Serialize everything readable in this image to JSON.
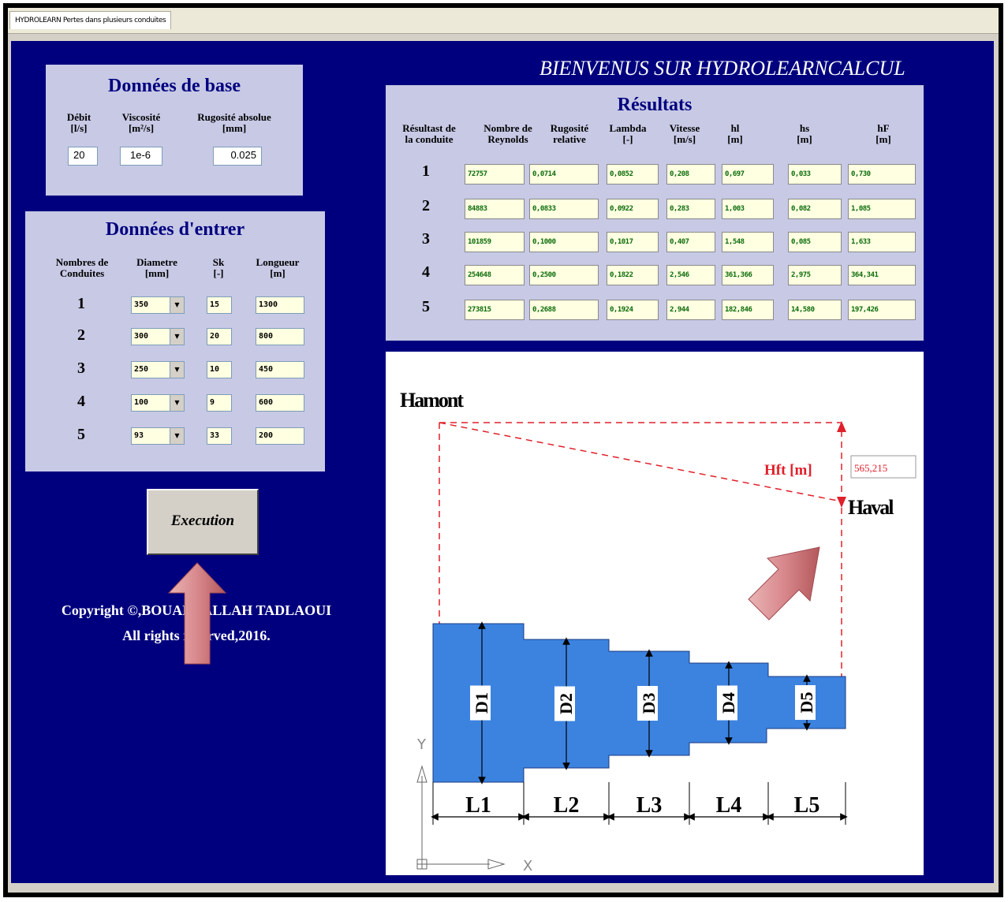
{
  "window": {
    "tab_title": "HYDROLEARN Pertes dans plusieurs conduites"
  },
  "app_title": "BIENVENUS SUR HYDROLEARNCALCUL",
  "base": {
    "title": "Données de base",
    "debit_label": [
      "Débit",
      "[l/s]"
    ],
    "visc_label": [
      "Viscosité",
      "[m²/s]"
    ],
    "rug_label": [
      "Rugosité absolue",
      "[mm]"
    ],
    "debit": "20",
    "viscosite": "1e-6",
    "rugosite": "0.025"
  },
  "entrer": {
    "title": "Données d'entrer",
    "headers": [
      [
        "Nombres de",
        "Conduites"
      ],
      [
        "Diametre",
        "[mm]"
      ],
      [
        "Sk",
        "[-]"
      ],
      [
        "Longueur",
        "[m]"
      ]
    ],
    "rows": [
      {
        "n": "1",
        "d": "350",
        "sk": "15",
        "l": "1300"
      },
      {
        "n": "2",
        "d": "300",
        "sk": "20",
        "l": "800"
      },
      {
        "n": "3",
        "d": "250",
        "sk": "10",
        "l": "450"
      },
      {
        "n": "4",
        "d": "100",
        "sk": "9",
        "l": "600"
      },
      {
        "n": "5",
        "d": "93",
        "sk": "33",
        "l": "200"
      }
    ]
  },
  "execute_label": "Execution",
  "copyright": [
    "Copyright ©,BOUABDALLAH TADLAOUI",
    "All rights reserved,2016."
  ],
  "results": {
    "title": "Résultats",
    "headers": [
      [
        "Résultast de",
        "la conduite"
      ],
      [
        "Nombre de",
        "Reynolds"
      ],
      [
        "Rugosité",
        "relative"
      ],
      [
        "Lambda",
        "[-]"
      ],
      [
        "Vitesse",
        "[m/s]"
      ],
      [
        "hl",
        "[m]"
      ],
      [
        "hs",
        "[m]"
      ],
      [
        "hF",
        "[m]"
      ]
    ],
    "rows": [
      {
        "n": "1",
        "v": [
          "72757",
          "0,0714",
          "0,0852",
          "0,208",
          "0,697",
          "0,033",
          "0,730"
        ]
      },
      {
        "n": "2",
        "v": [
          "84883",
          "0,0833",
          "0,0922",
          "0,283",
          "1,003",
          "0,082",
          "1,085"
        ]
      },
      {
        "n": "3",
        "v": [
          "101859",
          "0,1000",
          "0,1017",
          "0,407",
          "1,548",
          "0,085",
          "1,633"
        ]
      },
      {
        "n": "4",
        "v": [
          "254648",
          "0,2500",
          "0,1822",
          "2,546",
          "361,366",
          "2,975",
          "364,341"
        ]
      },
      {
        "n": "5",
        "v": [
          "273815",
          "0,2688",
          "0,1924",
          "2,944",
          "182,846",
          "14,580",
          "197,426"
        ]
      }
    ]
  },
  "diagram": {
    "hamont": "Hamont",
    "haval": "Haval",
    "hft_label": "Hft [m]",
    "hft_value": "565,215",
    "diam_labels": [
      "D1",
      "D2",
      "D3",
      "D4",
      "D5"
    ],
    "len_labels": [
      "L1",
      "L2",
      "L3",
      "L4",
      "L5"
    ],
    "axis_y": "Y",
    "axis_x": "X"
  },
  "colors": {
    "background": "#00007e",
    "panel": "#c7c9e5",
    "pipe": "#3c83e0",
    "hydraulic_line": "#e0202a",
    "result_text": "#0a6b0a"
  }
}
